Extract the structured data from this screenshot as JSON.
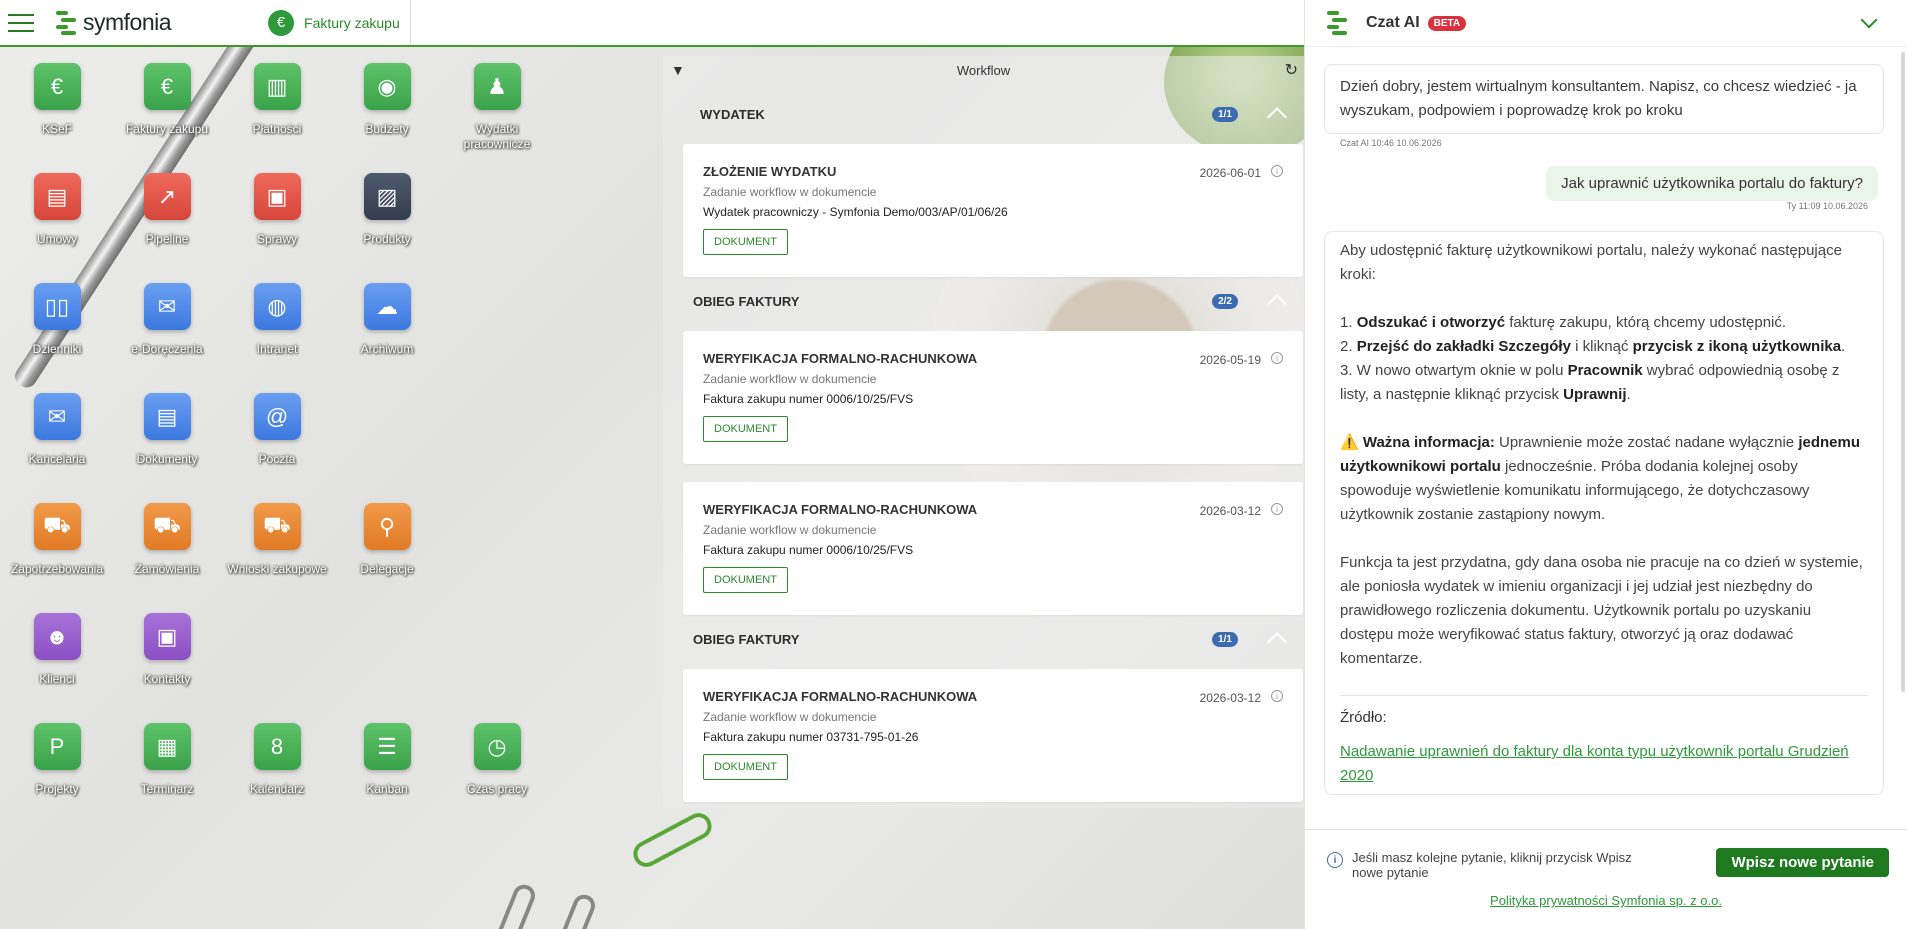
{
  "topbar": {
    "logo_text": "symfonia",
    "module_label": "Faktury zakupu",
    "module_icon": "€"
  },
  "tiles": [
    {
      "label": "KSeF",
      "icon": "euro-icon",
      "glyph": "€",
      "color": "green"
    },
    {
      "label": "Faktury zakupu",
      "icon": "euro-icon",
      "glyph": "€",
      "color": "green"
    },
    {
      "label": "Płatności",
      "icon": "banknotes-icon",
      "glyph": "▥",
      "color": "green"
    },
    {
      "label": "Budżety",
      "icon": "wallet-icon",
      "glyph": "◉",
      "color": "green"
    },
    {
      "label": "Wydatki pracownicze",
      "icon": "employee-money-icon",
      "glyph": "♟",
      "color": "green"
    },
    {
      "label": "Umowy",
      "icon": "contract-icon",
      "glyph": "▤",
      "color": "red"
    },
    {
      "label": "Pipeline",
      "icon": "chart-icon",
      "glyph": "↗",
      "color": "red"
    },
    {
      "label": "Sprawy",
      "icon": "briefcase-icon",
      "glyph": "▣",
      "color": "red"
    },
    {
      "label": "Produkty",
      "icon": "box-icon",
      "glyph": "▨",
      "color": "navy"
    },
    {
      "label": "Dzienniki",
      "icon": "book-icon",
      "glyph": "▯▯",
      "color": "blue"
    },
    {
      "label": "e-Doręczenia",
      "icon": "mail-arrow-icon",
      "glyph": "✉",
      "color": "blue"
    },
    {
      "label": "Intranet",
      "icon": "globe-window-icon",
      "glyph": "◍",
      "color": "blue"
    },
    {
      "label": "Archiwum",
      "icon": "cloud-icon",
      "glyph": "☁",
      "color": "blue"
    },
    {
      "label": "Kancelaria",
      "icon": "envelope-icon",
      "glyph": "✉",
      "color": "blue"
    },
    {
      "label": "Dokumenty",
      "icon": "document-icon",
      "glyph": "▤",
      "color": "blue"
    },
    {
      "label": "Poczta",
      "icon": "at-mail-icon",
      "glyph": "@",
      "color": "blue"
    },
    {
      "label": "Zapotrzebowania",
      "icon": "cart-icon",
      "glyph": "⛟",
      "color": "orange"
    },
    {
      "label": "Zamówienia",
      "icon": "cart-box-icon",
      "glyph": "⛟",
      "color": "orange"
    },
    {
      "label": "Wnioski zakupowe",
      "icon": "cart-box-icon",
      "glyph": "⛟",
      "color": "orange"
    },
    {
      "label": "Delegacje",
      "icon": "walking-person-icon",
      "glyph": "⚲",
      "color": "orange"
    },
    {
      "label": "Klienci",
      "icon": "people-icon",
      "glyph": "☻",
      "color": "purple"
    },
    {
      "label": "Kontakty",
      "icon": "contact-card-icon",
      "glyph": "▣",
      "color": "purple"
    },
    {
      "label": "Projekty",
      "icon": "project-icon",
      "glyph": "P",
      "color": "green"
    },
    {
      "label": "Terminarz",
      "icon": "calendar-clock-icon",
      "glyph": "▦",
      "color": "green"
    },
    {
      "label": "Kalendarz",
      "icon": "calendar-icon",
      "glyph": "8",
      "color": "green"
    },
    {
      "label": "Kanban",
      "icon": "checklist-icon",
      "glyph": "☰",
      "color": "green"
    },
    {
      "label": "Czas pracy",
      "icon": "stopwatch-icon",
      "glyph": "◷",
      "color": "green"
    }
  ],
  "workflow": {
    "title": "Workflow",
    "sections": [
      {
        "name": "WYDATEK",
        "badge": "1/1",
        "cards": [
          {
            "title": "ZŁOŻENIE WYDATKU",
            "date": "2026-06-01",
            "subtitle": "Zadanie workflow w dokumencie",
            "document": "Wydatek pracowniczy - Symfonia Demo/003/AP/01/06/26",
            "button": "DOKUMENT"
          }
        ]
      },
      {
        "name": "OBIEG FAKTURY",
        "badge": "2/2",
        "cards": [
          {
            "title": "WERYFIKACJA FORMALNO-RACHUNKOWA",
            "date": "2026-05-19",
            "subtitle": "Zadanie workflow w dokumencie",
            "document": "Faktura zakupu numer 0006/10/25/FVS",
            "button": "DOKUMENT"
          },
          {
            "title": "WERYFIKACJA FORMALNO-RACHUNKOWA",
            "date": "2026-03-12",
            "subtitle": "Zadanie workflow w dokumencie",
            "document": "Faktura zakupu numer 0006/10/25/FVS",
            "button": "DOKUMENT"
          }
        ]
      },
      {
        "name": "OBIEG FAKTURY",
        "badge": "1/1",
        "cards": [
          {
            "title": "WERYFIKACJA FORMALNO-RACHUNKOWA",
            "date": "2026-03-12",
            "subtitle": "Zadanie workflow w dokumencie",
            "document": "Faktura zakupu numer 03731-795-01-26",
            "button": "DOKUMENT"
          }
        ]
      }
    ]
  },
  "chat": {
    "title": "Czat AI",
    "badge": "BETA",
    "greeting": "Dzień dobry, jestem wirtualnym konsultantem. Napisz, co chcesz wiedzieć - ja wyszukam, podpowiem i poprowadzę krok po kroku",
    "greeting_meta": "Czat AI 10:46 10.06.2026",
    "user_question": "Jak uprawnić użytkownika portalu do faktury?",
    "user_meta": "Ty 11:09 10.06.2026",
    "answer": {
      "intro": "Aby udostępnić fakturę użytkownikowi portalu, należy wykonać następujące kroki:",
      "step1_pre": "1. ",
      "step1_bold": "Odszukać i otworzyć",
      "step1_post": " fakturę zakupu, którą chcemy udostępnić.",
      "step2_pre": "2. ",
      "step2_bold1": "Przejść do zakładki Szczegóły",
      "step2_mid": " i kliknąć ",
      "step2_bold2": "przycisk z ikoną użytkownika",
      "step2_post": ".",
      "step3_pre": "3. W nowo otwartym oknie w polu ",
      "step3_bold1": "Pracownik",
      "step3_mid": " wybrać odpowiednią osobę z listy, a następnie kliknąć przycisk ",
      "step3_bold2": "Uprawnij",
      "step3_post": ".",
      "warning_icon": "⚠️",
      "warning_bold1": "Ważna informacja:",
      "warning_text1": " Uprawnienie może zostać nadane wyłącznie ",
      "warning_bold2": "jednemu użytkownikowi portalu",
      "warning_text2": " jednocześnie. Próba dodania kolejnej osoby spowoduje wyświetlenie komunikatu informującego, że dotychczasowy użytkownik zostanie zastąpiony nowym.",
      "paragraph": "Funkcja ta jest przydatna, gdy dana osoba nie pracuje na co dzień w systemie, ale poniosła wydatek w imieniu organizacji i jej udział jest niezbędny do prawidłowego rozliczenia dokumentu. Użytkownik portalu po uzyskaniu dostępu może weryfikować status faktury, otworzyć ją oraz dodawać komentarze.",
      "source_label": "Źródło:",
      "source_link": "Nadawanie uprawnień do faktury dla konta typu użytkownik portalu Grudzień 2020"
    },
    "footer_info": "Jeśli masz kolejne pytanie, kliknij przycisk Wpisz nowe pytanie",
    "new_question_button": "Wpisz nowe pytanie",
    "privacy_link": "Polityka prywatności Symfonia sp. z o.o."
  },
  "colors": {
    "brand_green": "#3c9a2a",
    "button_green": "#1f7a1f",
    "badge_blue": "#3b6bb0",
    "beta_red": "#d9323e"
  }
}
